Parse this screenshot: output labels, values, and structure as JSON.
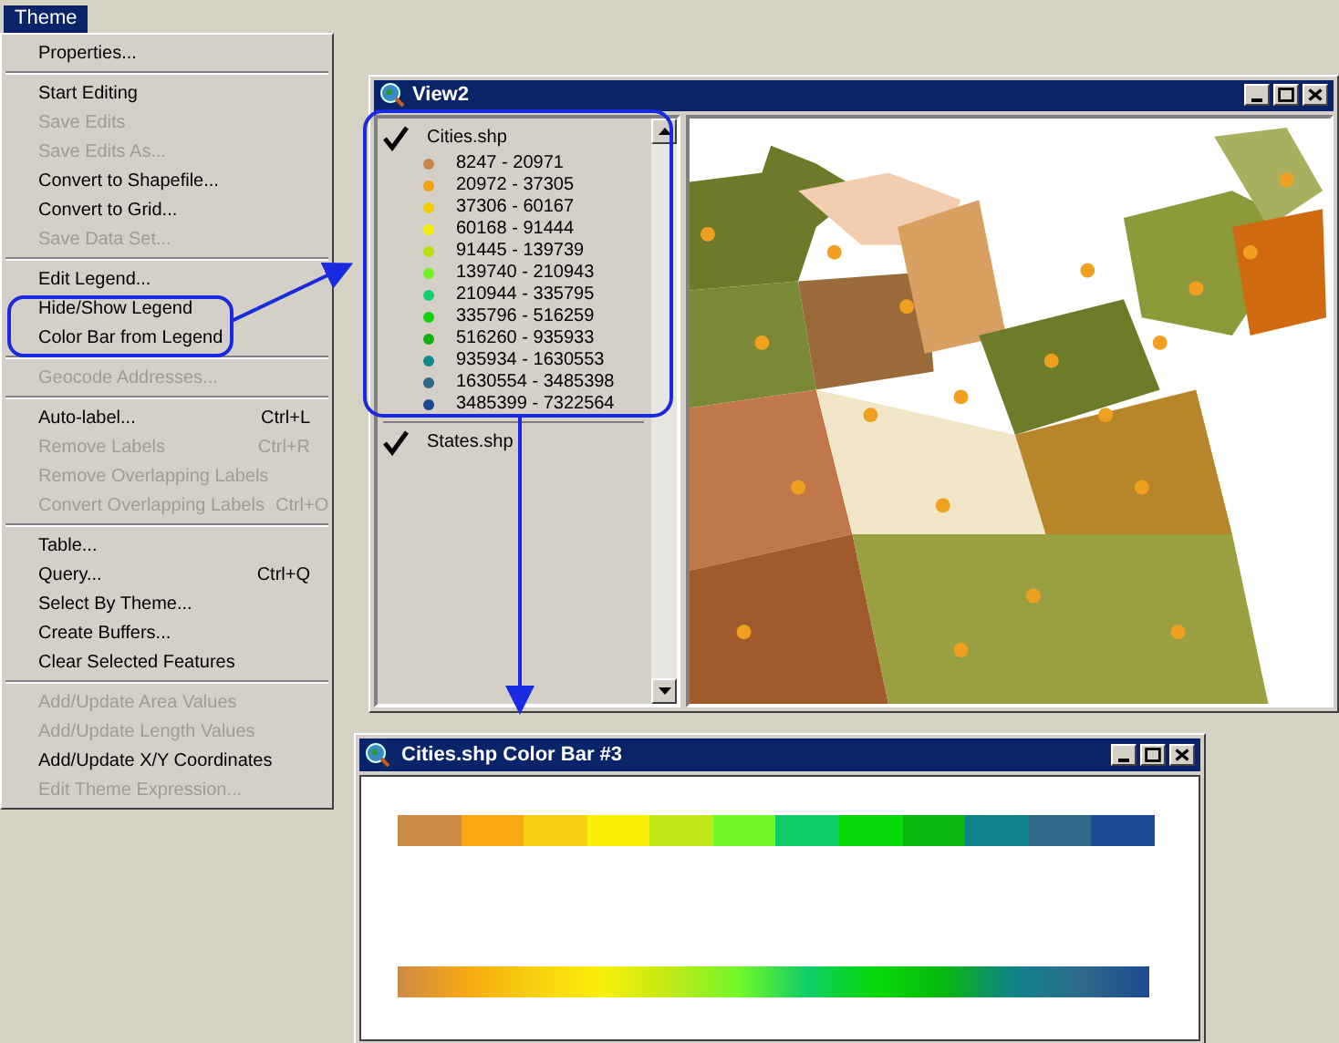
{
  "menu_bar": {
    "items": [
      {
        "label": "Theme",
        "selected": true
      }
    ]
  },
  "menu": {
    "items": [
      {
        "kind": "item",
        "label": "Properties...",
        "disabled": false
      },
      {
        "kind": "separator"
      },
      {
        "kind": "item",
        "label": "Start Editing",
        "disabled": false
      },
      {
        "kind": "item",
        "label": "Save Edits",
        "disabled": true
      },
      {
        "kind": "item",
        "label": "Save Edits As...",
        "disabled": true
      },
      {
        "kind": "item",
        "label": "Convert to Shapefile...",
        "disabled": false
      },
      {
        "kind": "item",
        "label": "Convert to Grid...",
        "disabled": false
      },
      {
        "kind": "item",
        "label": "Save Data Set...",
        "disabled": true
      },
      {
        "kind": "separator"
      },
      {
        "kind": "item",
        "label": "Edit Legend...",
        "disabled": false
      },
      {
        "kind": "item",
        "label": "Hide/Show Legend",
        "disabled": false
      },
      {
        "kind": "item",
        "label": "Color Bar from Legend",
        "disabled": false
      },
      {
        "kind": "separator"
      },
      {
        "kind": "item",
        "label": "Geocode Addresses...",
        "disabled": true
      },
      {
        "kind": "separator"
      },
      {
        "kind": "item",
        "label": "Auto-label...",
        "shortcut": "Ctrl+L",
        "disabled": false
      },
      {
        "kind": "item",
        "label": "Remove Labels",
        "shortcut": "Ctrl+R",
        "disabled": true
      },
      {
        "kind": "item",
        "label": "Remove Overlapping Labels",
        "disabled": true
      },
      {
        "kind": "item",
        "label": "Convert Overlapping Labels",
        "shortcut": "Ctrl+O",
        "disabled": true
      },
      {
        "kind": "separator"
      },
      {
        "kind": "item",
        "label": "Table...",
        "disabled": false
      },
      {
        "kind": "item",
        "label": "Query...",
        "shortcut": "Ctrl+Q",
        "disabled": false
      },
      {
        "kind": "item",
        "label": "Select By Theme...",
        "disabled": false
      },
      {
        "kind": "item",
        "label": "Create Buffers...",
        "disabled": false
      },
      {
        "kind": "item",
        "label": "Clear Selected Features",
        "disabled": false
      },
      {
        "kind": "separator"
      },
      {
        "kind": "item",
        "label": "Add/Update Area Values",
        "disabled": true
      },
      {
        "kind": "item",
        "label": "Add/Update Length Values",
        "disabled": true
      },
      {
        "kind": "item",
        "label": "Add/Update X/Y Coordinates",
        "disabled": false
      },
      {
        "kind": "item",
        "label": "Edit Theme Expression...",
        "disabled": true
      }
    ]
  },
  "view_window": {
    "title": "View2",
    "themes": [
      {
        "name": "Cities.shp",
        "checked": true,
        "classes": [
          {
            "range": "8247 - 20971",
            "color": "#c8844a"
          },
          {
            "range": "20972 - 37305",
            "color": "#f5a010"
          },
          {
            "range": "37306 - 60167",
            "color": "#f5cc00"
          },
          {
            "range": "60168 - 91444",
            "color": "#f5f000"
          },
          {
            "range": "91445 - 139739",
            "color": "#b8e010"
          },
          {
            "range": "139740 - 210943",
            "color": "#70f020"
          },
          {
            "range": "210944 - 335795",
            "color": "#10d070"
          },
          {
            "range": "335796 - 516259",
            "color": "#10d010"
          },
          {
            "range": "516260 - 935933",
            "color": "#10b010"
          },
          {
            "range": "935934 - 1630553",
            "color": "#108888"
          },
          {
            "range": "1630554 - 3485398",
            "color": "#306888"
          },
          {
            "range": "3485399 - 7322564",
            "color": "#1c4890"
          }
        ]
      },
      {
        "name": "States.shp",
        "checked": true
      }
    ]
  },
  "color_bar_window": {
    "title": "Cities.shp Color Bar #3",
    "segments": [
      {
        "color": "#cd8a48"
      },
      {
        "color": "#f8a812"
      },
      {
        "color": "#f8d010"
      },
      {
        "color": "#f8f008"
      },
      {
        "color": "#c0e818"
      },
      {
        "color": "#70f828"
      },
      {
        "color": "#10cc68"
      },
      {
        "color": "#08d808"
      },
      {
        "color": "#08b810"
      },
      {
        "color": "#10828a"
      },
      {
        "color": "#2e6a88"
      },
      {
        "color": "#1c4a94"
      }
    ]
  }
}
